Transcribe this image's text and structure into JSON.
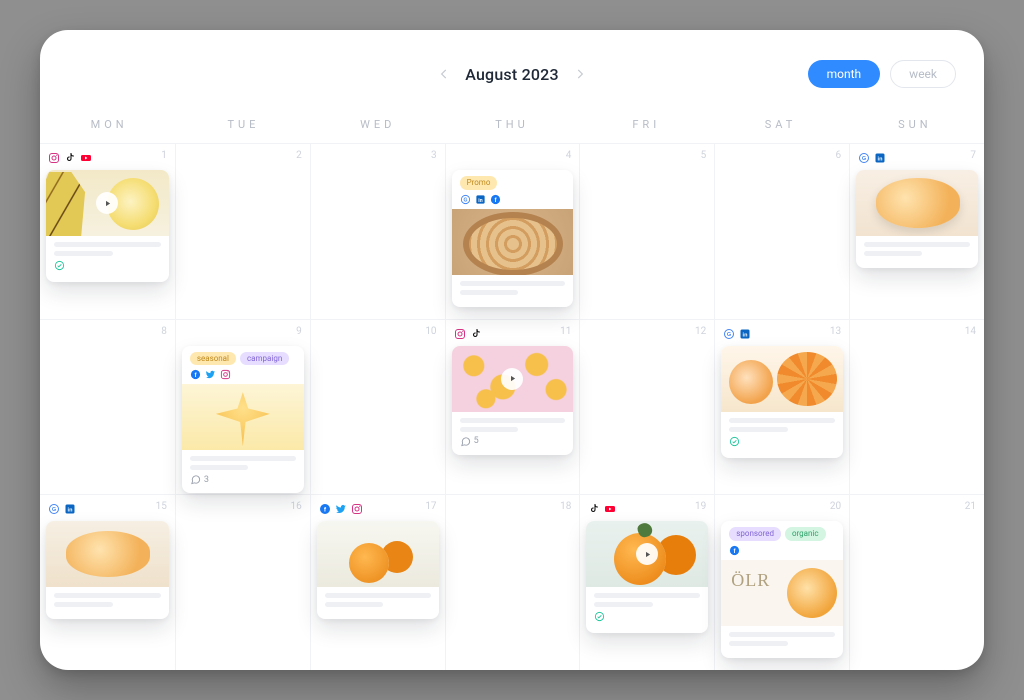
{
  "header": {
    "title": "August 2023",
    "views": {
      "month": "month",
      "week": "week"
    },
    "active_view": "month"
  },
  "weekdays": [
    "MON",
    "TUE",
    "WED",
    "THU",
    "FRI",
    "SAT",
    "SUN"
  ],
  "icons": {
    "instagram": "instagram",
    "tiktok": "tiktok",
    "youtube": "youtube",
    "google": "google",
    "linkedin": "linkedin",
    "facebook": "facebook",
    "twitter": "twitter"
  },
  "cells": [
    {
      "day": 1,
      "corner": [
        "instagram",
        "tiktok",
        "youtube"
      ],
      "card": {
        "thumb": "art1",
        "play": true,
        "footer": "check"
      }
    },
    {
      "day": 2
    },
    {
      "day": 3
    },
    {
      "day": 4,
      "card": {
        "tags": [
          {
            "text": "Promo",
            "style": "yellow"
          }
        ],
        "icons": [
          "google",
          "linkedin",
          "facebook"
        ],
        "thumb": "art2",
        "footer": "bars"
      }
    },
    {
      "day": 5
    },
    {
      "day": 6
    },
    {
      "day": 7,
      "corner": [
        "google",
        "linkedin"
      ],
      "card": {
        "thumb": "art3",
        "footer": "bars"
      }
    },
    {
      "day": 8
    },
    {
      "day": 9,
      "card": {
        "tags": [
          {
            "text": "seasonal",
            "style": "yellow"
          },
          {
            "text": "campaign",
            "style": "purple"
          }
        ],
        "icons": [
          "facebook",
          "twitter",
          "instagram"
        ],
        "thumb": "art4",
        "footer": "comments",
        "comments": 3
      }
    },
    {
      "day": 10
    },
    {
      "day": 11,
      "corner": [
        "instagram",
        "tiktok"
      ],
      "card": {
        "thumb": "art5",
        "play": true,
        "footer": "comments",
        "comments": 5
      }
    },
    {
      "day": 12
    },
    {
      "day": 13,
      "corner": [
        "google",
        "linkedin"
      ],
      "card": {
        "thumb": "art6",
        "footer": "check"
      }
    },
    {
      "day": 14
    },
    {
      "day": 15,
      "corner": [
        "google",
        "linkedin"
      ],
      "card": {
        "thumb": "art7",
        "footer": "bars"
      }
    },
    {
      "day": 16
    },
    {
      "day": 17,
      "corner": [
        "facebook",
        "twitter",
        "instagram"
      ],
      "card": {
        "thumb": "art8"
      }
    },
    {
      "day": 18
    },
    {
      "day": 19,
      "corner": [
        "tiktok",
        "youtube"
      ],
      "card": {
        "thumb": "art9",
        "play": true,
        "footer": "check"
      }
    },
    {
      "day": 20,
      "card": {
        "tags": [
          {
            "text": "sponsored",
            "style": "purple"
          },
          {
            "text": "organic",
            "style": "green"
          }
        ],
        "icons": [
          "facebook"
        ],
        "thumb": "art10"
      }
    },
    {
      "day": 21
    }
  ]
}
